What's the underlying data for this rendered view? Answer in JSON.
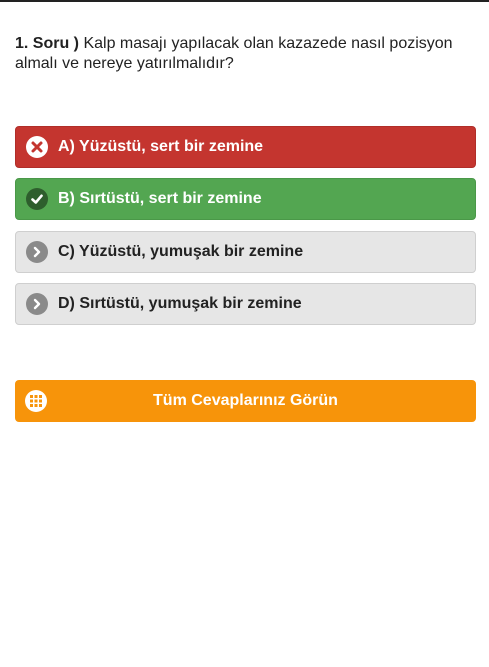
{
  "question": {
    "number_label": "1. Soru )",
    "text": " Kalp masajı yapılacak olan kazazede nasıl pozisyon almalı ve nereye yatırılmalıdır?"
  },
  "options": [
    {
      "label": "A) Yüzüstü, sert bir zemine",
      "state": "wrong",
      "icon": "close-icon"
    },
    {
      "label": "B) Sırtüstü, sert bir zemine",
      "state": "correct",
      "icon": "check-icon"
    },
    {
      "label": "C) Yüzüstü, yumuşak bir zemine",
      "state": "neutral",
      "icon": "chevron-right-icon"
    },
    {
      "label": "D) Sırtüstü, yumuşak bir zemine",
      "state": "neutral",
      "icon": "chevron-right-icon"
    }
  ],
  "all_answers_button": {
    "label": "Tüm Cevaplarınız Görün",
    "icon": "grid-icon"
  },
  "colors": {
    "wrong": "#c4352f",
    "correct": "#53a651",
    "neutral": "#e6e6e6",
    "accent": "#f7940a"
  }
}
